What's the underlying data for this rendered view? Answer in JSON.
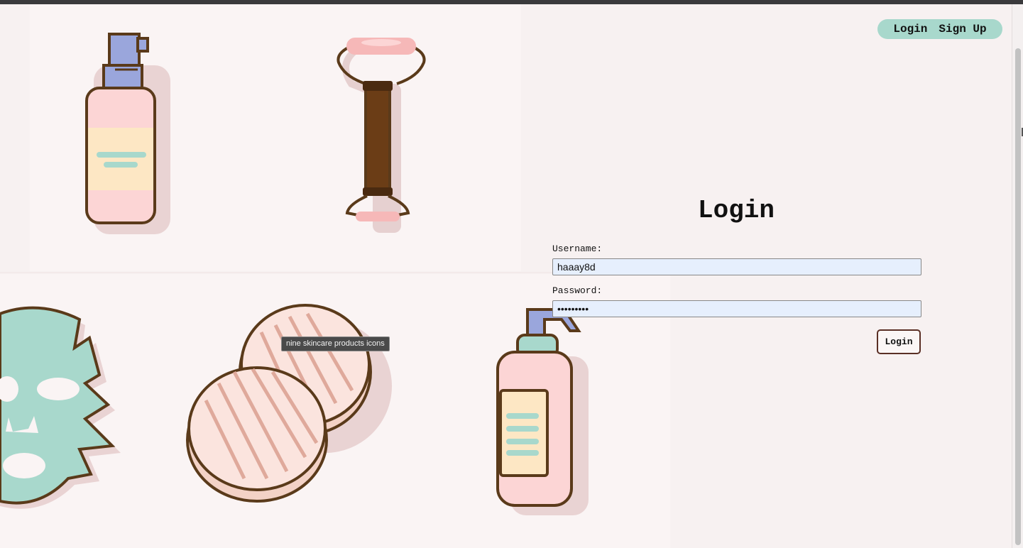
{
  "nav": {
    "login_label": "Login",
    "signup_label": "Sign Up"
  },
  "login": {
    "title": "Login",
    "username_label": "Username:",
    "username_value": "haaay8d",
    "password_label": "Password:",
    "password_value": "hunter123",
    "submit_label": "Login"
  },
  "illustration": {
    "tooltip": "nine skincare products icons"
  },
  "colors": {
    "accent": "#a8d8cc",
    "outline": "#5a3a1a",
    "pink": "#f8c9c9",
    "lavender": "#9aa6dc",
    "cream": "#fde7c4",
    "background": "#f7f1f1"
  }
}
